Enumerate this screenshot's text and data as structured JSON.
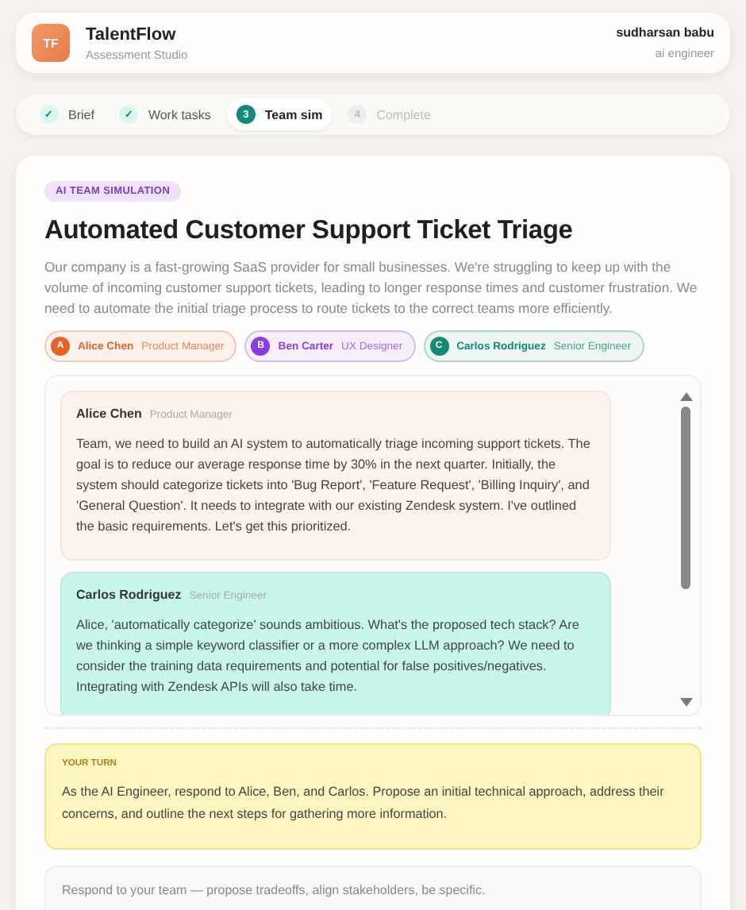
{
  "header": {
    "logo": "TF",
    "app_name": "TalentFlow",
    "subtitle": "Assessment Studio",
    "user_name": "sudharsan babu",
    "user_role": "ai engineer"
  },
  "steps": [
    {
      "marker": "✓",
      "label": "Brief",
      "kind": "done",
      "selected": false
    },
    {
      "marker": "✓",
      "label": "Work tasks",
      "kind": "done",
      "selected": false
    },
    {
      "marker": "3",
      "label": "Team sim",
      "kind": "current",
      "selected": true
    },
    {
      "marker": "4",
      "label": "Complete",
      "kind": "pending",
      "selected": false
    }
  ],
  "simulation": {
    "badge": "AI TEAM SIMULATION",
    "title": "Automated Customer Support Ticket Triage",
    "description": "Our company is a fast-growing SaaS provider for small businesses. We're struggling to keep up with the volume of incoming customer support tickets, leading to longer response times and customer frustration. We need to automate the initial triage process to route tickets to the correct teams more efficiently.",
    "participants": [
      {
        "initial": "A",
        "name": "Alice Chen",
        "role": "Product Manager",
        "color": "#e8622a"
      },
      {
        "initial": "B",
        "name": "Ben Carter",
        "role": "UX Designer",
        "color": "#8a3ee0"
      },
      {
        "initial": "C",
        "name": "Carlos Rodriguez",
        "role": "Senior Engineer",
        "color": "#138a78"
      }
    ],
    "messages": [
      {
        "name": "Alice Chen",
        "role": "Product Manager",
        "color": "#fdf3ea",
        "text": "Team, we need to build an AI system to automatically triage incoming support tickets. The goal is to reduce our average response time by 30% in the next quarter. Initially, the system should categorize tickets into 'Bug Report', 'Feature Request', 'Billing Inquiry', and 'General Question'. It needs to integrate with our existing Zendesk system. I've outlined the basic requirements. Let's get this prioritized."
      },
      {
        "name": "Carlos Rodriguez",
        "role": "Senior Engineer",
        "color": "#c9f6ec",
        "text": "Alice, 'automatically categorize' sounds ambitious. What's the proposed tech stack? Are we thinking a simple keyword classifier or a more complex LLM approach? We need to consider the training data requirements and potential for false positives/negatives. Integrating with Zendesk APIs will also take time."
      }
    ],
    "your_turn": {
      "label": "YOUR TURN",
      "text": "As the AI Engineer, respond to Alice, Ben, and Carlos. Propose an initial technical approach, address their concerns, and outline the next steps for gathering more information."
    },
    "response": {
      "placeholder": "Respond to your team — propose tradeoffs, align stakeholders, be specific."
    }
  }
}
